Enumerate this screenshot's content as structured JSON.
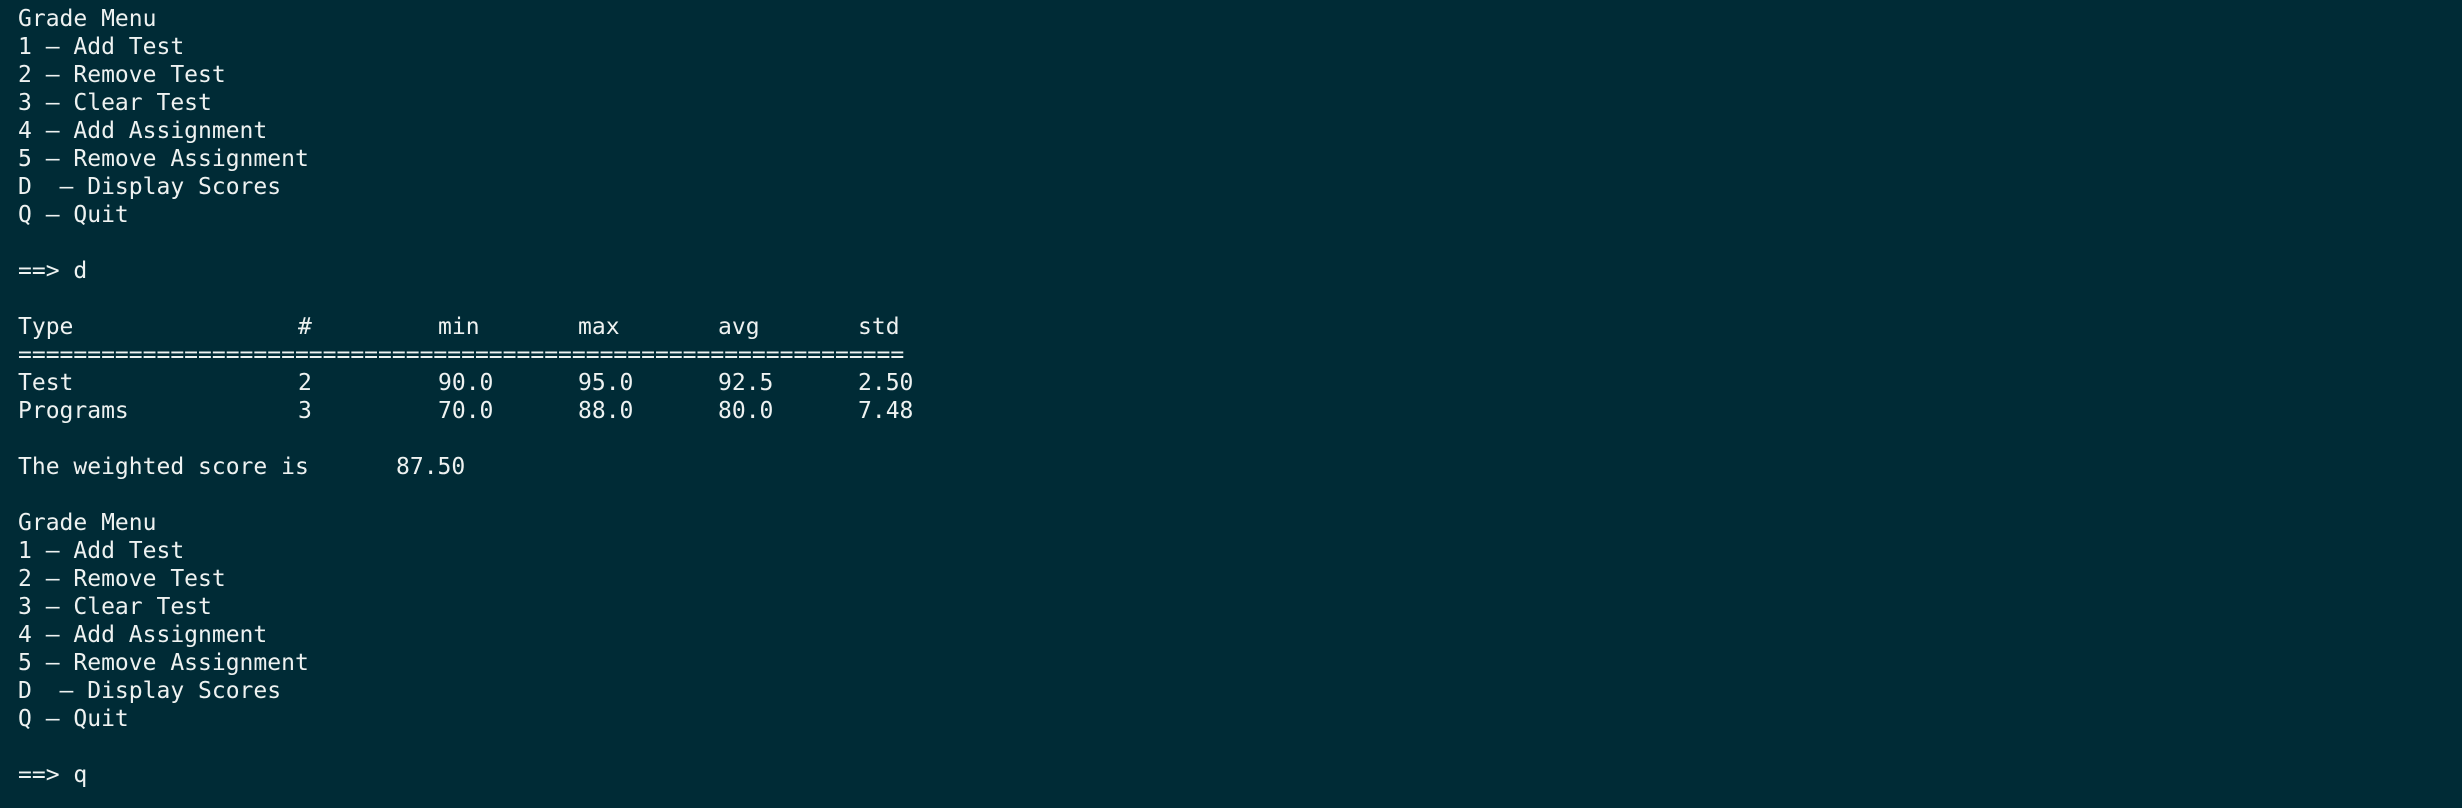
{
  "menu_first": {
    "title": "Grade Menu",
    "items": [
      "1 – Add Test",
      "2 – Remove Test",
      "3 – Clear Test",
      "4 – Add Assignment",
      "5 – Remove Assignment",
      "D  – Display Scores",
      "Q – Quit"
    ]
  },
  "prompt_first": "==> d",
  "table": {
    "headers": [
      "Type",
      "#",
      "min",
      "max",
      "avg",
      "std"
    ],
    "separator": "================================================================",
    "rows": [
      [
        "Test",
        "2",
        "90.0",
        "95.0",
        "92.5",
        "2.50"
      ],
      [
        "Programs",
        "3",
        "70.0",
        "88.0",
        "80.0",
        "7.48"
      ]
    ]
  },
  "weighted": {
    "label": "The weighted score is",
    "value": "87.50"
  },
  "menu_second": {
    "title": "Grade Menu",
    "items": [
      "1 – Add Test",
      "2 – Remove Test",
      "3 – Clear Test",
      "4 – Add Assignment",
      "5 – Remove Assignment",
      "D  – Display Scores",
      "Q – Quit"
    ]
  },
  "prompt_second": "==> q",
  "colors": {
    "background": "#002b36",
    "text": "#eef2f1"
  }
}
